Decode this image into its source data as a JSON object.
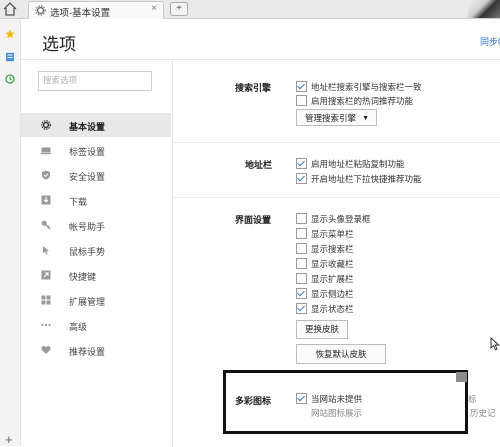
{
  "tab": {
    "label": "选项-基本设置",
    "close": "×",
    "new": "+"
  },
  "header": {
    "title": "选项",
    "sync": "同步帐"
  },
  "search": {
    "placeholder": "搜索选项"
  },
  "sidebar": {
    "items": [
      {
        "label": "基本设置",
        "icon": "gear-icon",
        "active": true
      },
      {
        "label": "标签设置",
        "icon": "tab-icon"
      },
      {
        "label": "安全设置",
        "icon": "shield-icon"
      },
      {
        "label": "下载",
        "icon": "download-icon"
      },
      {
        "label": "帐号助手",
        "icon": "key-icon"
      },
      {
        "label": "鼠标手势",
        "icon": "mouse-icon"
      },
      {
        "label": "快捷键",
        "icon": "shortcut-icon"
      },
      {
        "label": "扩展管理",
        "icon": "extensions-icon"
      },
      {
        "label": "高级",
        "icon": "more-icon"
      },
      {
        "label": "推荐设置",
        "icon": "heart-icon"
      }
    ]
  },
  "search_engine": {
    "title": "搜索引擎",
    "opt1": "地址栏搜索引擎与搜索栏一致",
    "opt2": "启用搜索栏的热词推荐功能",
    "manage": "管理搜索引擎",
    "manage_arrow": "▼"
  },
  "address_bar": {
    "title": "地址栏",
    "opt1": "启用地址栏粘贴复制功能",
    "opt2": "开启地址栏下拉快捷推荐功能"
  },
  "ui_settings": {
    "title": "界面设置",
    "opts": [
      "显示头像登录框",
      "显示菜单栏",
      "显示搜索栏",
      "显示收藏栏",
      "显示扩展栏",
      "显示侧边栏",
      "显示状态栏"
    ],
    "change_skin": "更换皮肤",
    "restore_skin": "恢复默认皮肤"
  },
  "colorful_icons": {
    "title": "多彩图标",
    "opt1": "当网站未提供",
    "desc": "网站图标展示",
    "right1": "标",
    "right2": "历史记"
  },
  "colors": {
    "check": "#3a7bd5",
    "link": "#2a6fd6",
    "active_bg": "#e8e8e8"
  }
}
